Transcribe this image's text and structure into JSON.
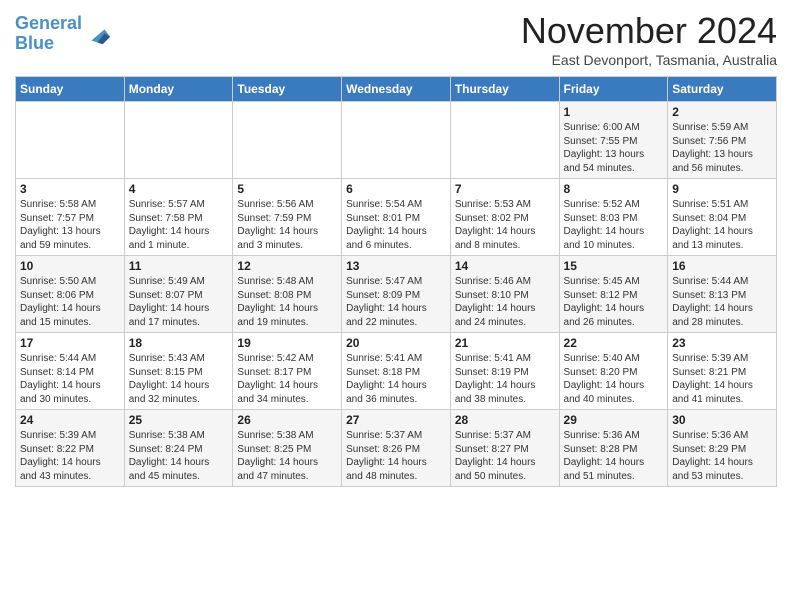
{
  "header": {
    "logo_line1": "General",
    "logo_line2": "Blue",
    "month_title": "November 2024",
    "location": "East Devonport, Tasmania, Australia"
  },
  "weekdays": [
    "Sunday",
    "Monday",
    "Tuesday",
    "Wednesday",
    "Thursday",
    "Friday",
    "Saturday"
  ],
  "weeks": [
    [
      {
        "day": "",
        "info": ""
      },
      {
        "day": "",
        "info": ""
      },
      {
        "day": "",
        "info": ""
      },
      {
        "day": "",
        "info": ""
      },
      {
        "day": "",
        "info": ""
      },
      {
        "day": "1",
        "info": "Sunrise: 6:00 AM\nSunset: 7:55 PM\nDaylight: 13 hours\nand 54 minutes."
      },
      {
        "day": "2",
        "info": "Sunrise: 5:59 AM\nSunset: 7:56 PM\nDaylight: 13 hours\nand 56 minutes."
      }
    ],
    [
      {
        "day": "3",
        "info": "Sunrise: 5:58 AM\nSunset: 7:57 PM\nDaylight: 13 hours\nand 59 minutes."
      },
      {
        "day": "4",
        "info": "Sunrise: 5:57 AM\nSunset: 7:58 PM\nDaylight: 14 hours\nand 1 minute."
      },
      {
        "day": "5",
        "info": "Sunrise: 5:56 AM\nSunset: 7:59 PM\nDaylight: 14 hours\nand 3 minutes."
      },
      {
        "day": "6",
        "info": "Sunrise: 5:54 AM\nSunset: 8:01 PM\nDaylight: 14 hours\nand 6 minutes."
      },
      {
        "day": "7",
        "info": "Sunrise: 5:53 AM\nSunset: 8:02 PM\nDaylight: 14 hours\nand 8 minutes."
      },
      {
        "day": "8",
        "info": "Sunrise: 5:52 AM\nSunset: 8:03 PM\nDaylight: 14 hours\nand 10 minutes."
      },
      {
        "day": "9",
        "info": "Sunrise: 5:51 AM\nSunset: 8:04 PM\nDaylight: 14 hours\nand 13 minutes."
      }
    ],
    [
      {
        "day": "10",
        "info": "Sunrise: 5:50 AM\nSunset: 8:06 PM\nDaylight: 14 hours\nand 15 minutes."
      },
      {
        "day": "11",
        "info": "Sunrise: 5:49 AM\nSunset: 8:07 PM\nDaylight: 14 hours\nand 17 minutes."
      },
      {
        "day": "12",
        "info": "Sunrise: 5:48 AM\nSunset: 8:08 PM\nDaylight: 14 hours\nand 19 minutes."
      },
      {
        "day": "13",
        "info": "Sunrise: 5:47 AM\nSunset: 8:09 PM\nDaylight: 14 hours\nand 22 minutes."
      },
      {
        "day": "14",
        "info": "Sunrise: 5:46 AM\nSunset: 8:10 PM\nDaylight: 14 hours\nand 24 minutes."
      },
      {
        "day": "15",
        "info": "Sunrise: 5:45 AM\nSunset: 8:12 PM\nDaylight: 14 hours\nand 26 minutes."
      },
      {
        "day": "16",
        "info": "Sunrise: 5:44 AM\nSunset: 8:13 PM\nDaylight: 14 hours\nand 28 minutes."
      }
    ],
    [
      {
        "day": "17",
        "info": "Sunrise: 5:44 AM\nSunset: 8:14 PM\nDaylight: 14 hours\nand 30 minutes."
      },
      {
        "day": "18",
        "info": "Sunrise: 5:43 AM\nSunset: 8:15 PM\nDaylight: 14 hours\nand 32 minutes."
      },
      {
        "day": "19",
        "info": "Sunrise: 5:42 AM\nSunset: 8:17 PM\nDaylight: 14 hours\nand 34 minutes."
      },
      {
        "day": "20",
        "info": "Sunrise: 5:41 AM\nSunset: 8:18 PM\nDaylight: 14 hours\nand 36 minutes."
      },
      {
        "day": "21",
        "info": "Sunrise: 5:41 AM\nSunset: 8:19 PM\nDaylight: 14 hours\nand 38 minutes."
      },
      {
        "day": "22",
        "info": "Sunrise: 5:40 AM\nSunset: 8:20 PM\nDaylight: 14 hours\nand 40 minutes."
      },
      {
        "day": "23",
        "info": "Sunrise: 5:39 AM\nSunset: 8:21 PM\nDaylight: 14 hours\nand 41 minutes."
      }
    ],
    [
      {
        "day": "24",
        "info": "Sunrise: 5:39 AM\nSunset: 8:22 PM\nDaylight: 14 hours\nand 43 minutes."
      },
      {
        "day": "25",
        "info": "Sunrise: 5:38 AM\nSunset: 8:24 PM\nDaylight: 14 hours\nand 45 minutes."
      },
      {
        "day": "26",
        "info": "Sunrise: 5:38 AM\nSunset: 8:25 PM\nDaylight: 14 hours\nand 47 minutes."
      },
      {
        "day": "27",
        "info": "Sunrise: 5:37 AM\nSunset: 8:26 PM\nDaylight: 14 hours\nand 48 minutes."
      },
      {
        "day": "28",
        "info": "Sunrise: 5:37 AM\nSunset: 8:27 PM\nDaylight: 14 hours\nand 50 minutes."
      },
      {
        "day": "29",
        "info": "Sunrise: 5:36 AM\nSunset: 8:28 PM\nDaylight: 14 hours\nand 51 minutes."
      },
      {
        "day": "30",
        "info": "Sunrise: 5:36 AM\nSunset: 8:29 PM\nDaylight: 14 hours\nand 53 minutes."
      }
    ]
  ]
}
